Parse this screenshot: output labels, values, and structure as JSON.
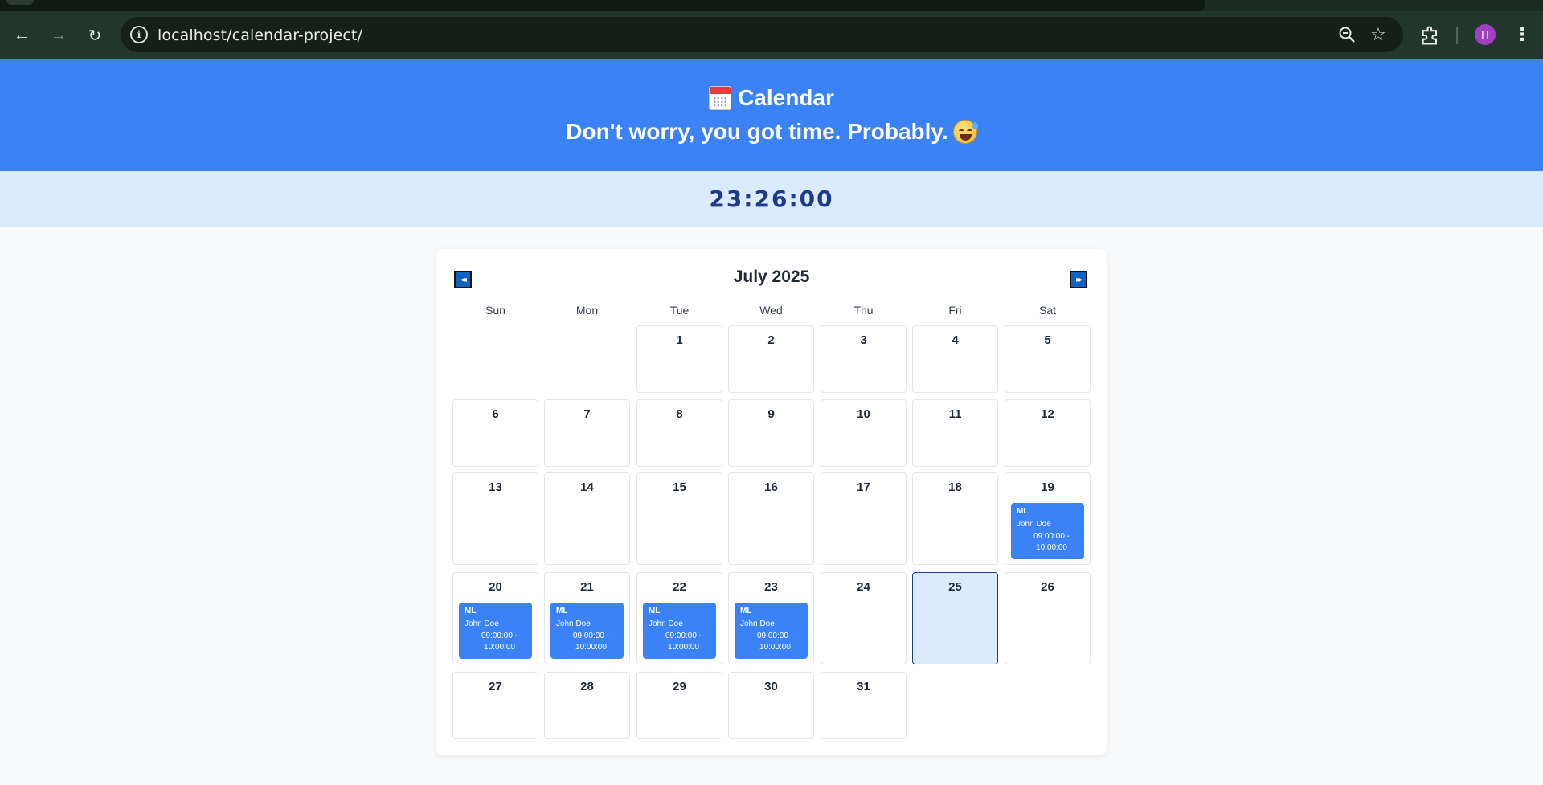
{
  "browser": {
    "url": "localhost/calendar-project/",
    "avatar_initial": "H",
    "icons": [
      "back-icon",
      "forward-icon",
      "reload-icon",
      "info-icon",
      "zoom-out-icon",
      "bookmark-star-icon",
      "extensions-icon",
      "kebab-menu-icon"
    ]
  },
  "header": {
    "title": "Calendar",
    "subtitle": "Don't worry, you got time. Probably.",
    "accent_color": "#3b82f6"
  },
  "clock": {
    "time": "23:26:00"
  },
  "calendar": {
    "month_label": "July 2025",
    "prev_label": "◂◂",
    "next_label": "▸▸",
    "weekdays": [
      "Sun",
      "Mon",
      "Tue",
      "Wed",
      "Thu",
      "Fri",
      "Sat"
    ],
    "today": "25",
    "days": [
      "1",
      "2",
      "3",
      "4",
      "5",
      "6",
      "7",
      "8",
      "9",
      "10",
      "11",
      "12",
      "13",
      "14",
      "15",
      "16",
      "17",
      "18",
      "19",
      "20",
      "21",
      "22",
      "23",
      "24",
      "25",
      "26",
      "27",
      "28",
      "29",
      "30",
      "31"
    ],
    "events": [
      {
        "day": "19",
        "title": "ML",
        "person": "John Doe",
        "time_start": "09:00:00 -",
        "time_end": "10:00:00"
      },
      {
        "day": "20",
        "title": "ML",
        "person": "John Doe",
        "time_start": "09:00:00 -",
        "time_end": "10:00:00"
      },
      {
        "day": "21",
        "title": "ML",
        "person": "John Doe",
        "time_start": "09:00:00 -",
        "time_end": "10:00:00"
      },
      {
        "day": "22",
        "title": "ML",
        "person": "John Doe",
        "time_start": "09:00:00 -",
        "time_end": "10:00:00"
      },
      {
        "day": "23",
        "title": "ML",
        "person": "John Doe",
        "time_start": "09:00:00 -",
        "time_end": "10:00:00"
      }
    ]
  }
}
